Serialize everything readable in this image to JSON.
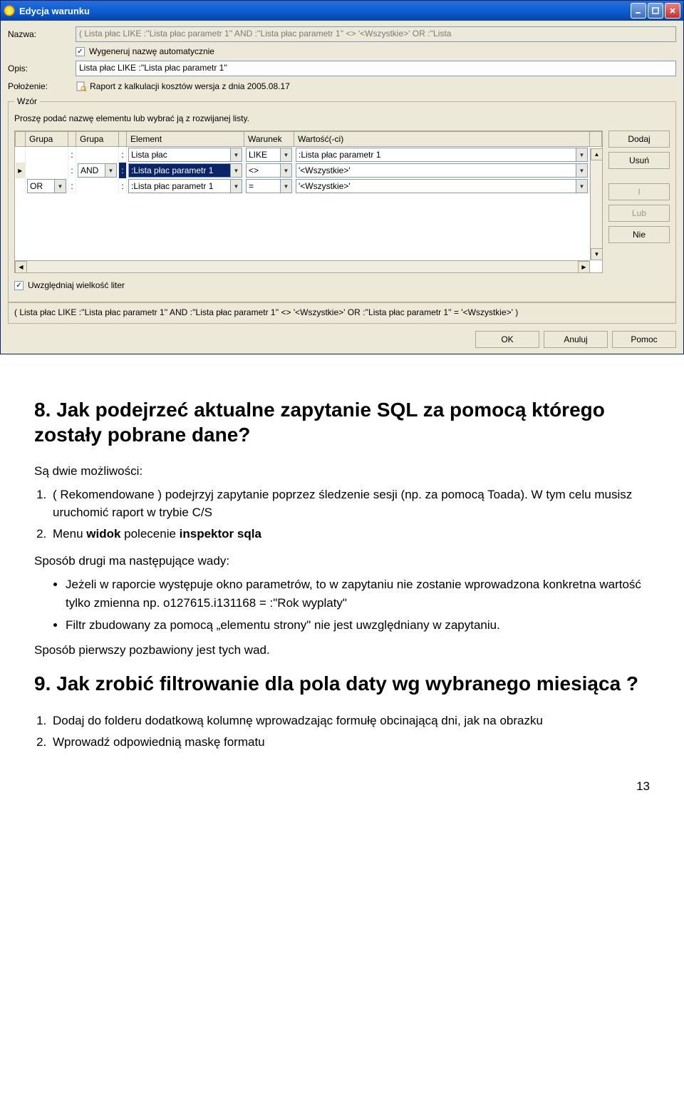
{
  "window": {
    "title": "Edycja warunku",
    "minimize": "_",
    "maximize": "□",
    "close": "×"
  },
  "form": {
    "nazwa_label": "Nazwa:",
    "nazwa_value": "( Lista płac LIKE :''Lista płac parametr 1'' AND :''Lista płac parametr 1'' <> '<Wszystkie>' OR :''Lista",
    "auto_label": "Wygeneruj nazwę automatycznie",
    "opis_label": "Opis:",
    "opis_value": "Lista płac LIKE :''Lista płac parametr 1''",
    "polozenie_label": "Położenie:",
    "polozenie_value": "Raport z kalkulacji kosztów wersja z dnia 2005.08.17"
  },
  "wzor": {
    "legend": "Wzór",
    "hint": "Proszę podać nazwę elementu lub wybrać ją z rozwijanej listy.",
    "headers": {
      "grupa1": "Grupa",
      "grupa2": "Grupa",
      "element": "Element",
      "warunek": "Warunek",
      "wartosc": "Wartość(-ci)"
    },
    "rows": [
      {
        "g1": "",
        "g2": "",
        "element": "Lista płac",
        "war": "LIKE",
        "val": ":Lista płac parametr 1"
      },
      {
        "g1": "",
        "g2": "AND",
        "element": ":Lista płac parametr 1",
        "war": "<>",
        "val": "'<Wszystkie>'",
        "sel": true
      },
      {
        "g1": "OR",
        "g2": "",
        "element": ":Lista płac parametr 1",
        "war": "=",
        "val": "'<Wszystkie>'"
      }
    ],
    "buttons": {
      "dodaj": "Dodaj",
      "usun": "Usuń",
      "i": "I",
      "lub": "Lub",
      "nie": "Nie"
    }
  },
  "case_label": "Uwzględniaj wielkość liter",
  "preview": "( Lista płac LIKE :''Lista płac parametr 1'' AND :''Lista płac parametr 1'' <> '<Wszystkie>' OR :''Lista płac parametr 1'' = '<Wszystkie>' )",
  "bottom": {
    "ok": "OK",
    "anuluj": "Anuluj",
    "pomoc": "Pomoc"
  },
  "doc": {
    "h8": "8. Jak podejrzeć aktualne zapytanie SQL za pomocą którego zostały pobrane dane?",
    "p1": "Są dwie możliwości:",
    "li1": "( Rekomendowane ) podejrzyj zapytanie poprzez śledzenie sesji (np. za pomocą Toada). W tym celu musisz uruchomić raport w trybie C/S",
    "li2_a": "Menu ",
    "li2_b": "widok",
    "li2_c": " polecenie ",
    "li2_d": "inspektor sqla",
    "p2": "Sposób drugi ma następujące wady:",
    "b1": "Jeżeli w raporcie występuje okno parametrów, to w zapytaniu nie zostanie wprowadzona konkretna wartość tylko zmienna np. o127615.i131168 = :\"Rok wyplaty\"",
    "b2": "Filtr zbudowany za pomocą „elementu strony\" nie jest uwzględniany w zapytaniu.",
    "p3": "Sposób pierwszy pozbawiony jest tych wad.",
    "h9": "9. Jak zrobić filtrowanie dla pola daty wg wybranego miesiąca ?",
    "li9_1": "Dodaj do folderu dodatkową kolumnę wprowadzając formułę obcinającą dni, jak na obrazku",
    "li9_2": "Wprowadź odpowiednią maskę formatu",
    "pagenum": "13"
  }
}
